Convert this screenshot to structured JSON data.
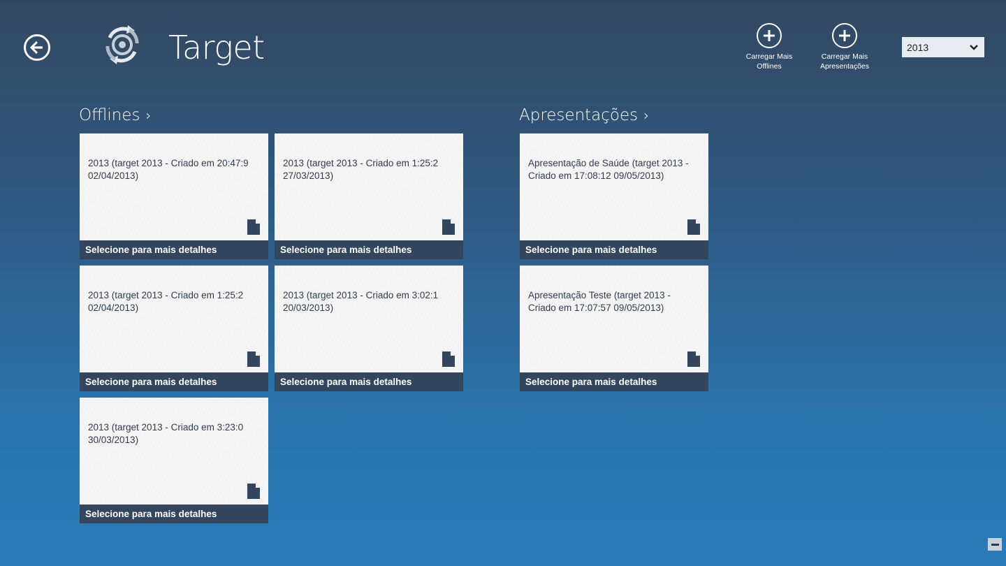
{
  "header": {
    "title": "Target",
    "actions": [
      {
        "label_line1": "Carregar Mais",
        "label_line2": "Offlines",
        "icon": "plus-circle-icon"
      },
      {
        "label_line1": "Carregar Mais",
        "label_line2": "Apresentações",
        "icon": "plus-circle-icon"
      }
    ],
    "year_select": {
      "value": "2013"
    }
  },
  "sections": {
    "offlines": {
      "title": "Offlines",
      "chevron": "›",
      "tiles": [
        {
          "text": "2013 (target 2013 - Criado em 20:47:9 02/04/2013)",
          "footer": "Selecione para mais detalhes"
        },
        {
          "text": "2013 (target 2013 - Criado em 1:25:2 27/03/2013)",
          "footer": "Selecione para mais detalhes"
        },
        {
          "text": "2013 (target 2013 - Criado em 1:25:2 02/04/2013)",
          "footer": "Selecione para mais detalhes"
        },
        {
          "text": "2013 (target 2013 - Criado em 3:02:1 20/03/2013)",
          "footer": "Selecione para mais detalhes"
        },
        {
          "text": "2013 (target 2013 - Criado em 3:23:0 30/03/2013)",
          "footer": "Selecione para mais detalhes"
        }
      ]
    },
    "apresentacoes": {
      "title": "Apresentações",
      "chevron": "›",
      "tiles": [
        {
          "text": "Apresentação de Saúde (target 2013 - Criado em 17:08:12 09/05/2013)",
          "footer": "Selecione para mais detalhes"
        },
        {
          "text": "Apresentação Teste (target 2013 - Criado em 17:07:57 09/05/2013)",
          "footer": "Selecione para mais detalhes"
        }
      ]
    }
  },
  "colors": {
    "tile_footer": "#33465e",
    "tile_bg": "#f5f5f5",
    "tile_text": "#2f3c4e"
  }
}
